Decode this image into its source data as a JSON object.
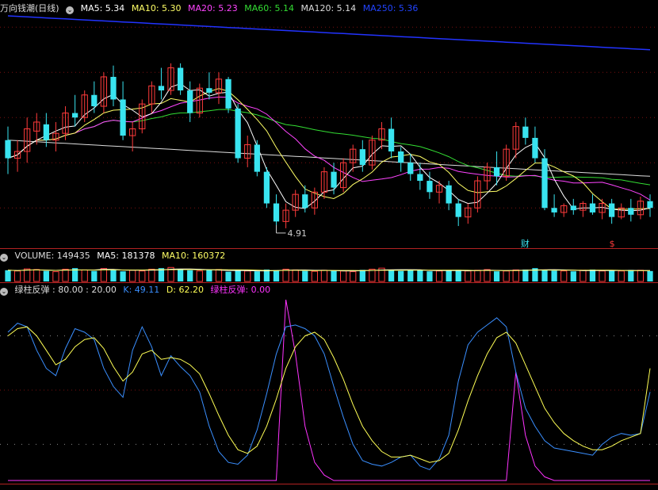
{
  "colors": {
    "up": "#ff3b3b",
    "down": "#39e4f0",
    "ma5": "#ffffff",
    "ma10": "#ffff66",
    "ma20": "#ff44ff",
    "ma60": "#33dd33",
    "ma120": "#dddddd",
    "ma250": "#2233ff",
    "k": "#3a8fff",
    "d": "#ffff55",
    "signal": "#ff33ff"
  },
  "icons": {
    "panel_toggle": "circle-chevron-down-icon"
  },
  "price_panel": {
    "title": "万向钱潮(日线)",
    "ma": [
      {
        "label": "MA5: 5.34"
      },
      {
        "label": "MA10: 5.30"
      },
      {
        "label": "MA20: 5.23"
      },
      {
        "label": "MA60: 5.14"
      },
      {
        "label": "MA120: 5.14"
      },
      {
        "label": "MA250: 5.36"
      }
    ],
    "low_marker": "4.91",
    "event_marks": [
      "财",
      "$"
    ]
  },
  "volume_panel": {
    "title": "VOLUME: 149435",
    "ma5": "MA5: 181378",
    "ma10": "MA10: 160372"
  },
  "indicator_panel": {
    "title": "绿柱反弹 : 80.00 : 20.00",
    "k": "K: 49.11",
    "d": "D: 62.20",
    "signal": "绿柱反弹: 0.00"
  },
  "chart_data": {
    "type": "candlestick",
    "bars": 68,
    "price_range": [
      4.85,
      5.85
    ],
    "ohlc_approx": [
      [
        5.3,
        5.36,
        5.15,
        5.22
      ],
      [
        5.22,
        5.3,
        5.16,
        5.25
      ],
      [
        5.25,
        5.4,
        5.2,
        5.35
      ],
      [
        5.34,
        5.42,
        5.28,
        5.38
      ],
      [
        5.37,
        5.42,
        5.27,
        5.3
      ],
      [
        5.3,
        5.38,
        5.25,
        5.33
      ],
      [
        5.33,
        5.45,
        5.3,
        5.42
      ],
      [
        5.42,
        5.5,
        5.36,
        5.4
      ],
      [
        5.4,
        5.52,
        5.38,
        5.5
      ],
      [
        5.5,
        5.56,
        5.42,
        5.45
      ],
      [
        5.45,
        5.6,
        5.42,
        5.58
      ],
      [
        5.58,
        5.63,
        5.45,
        5.48
      ],
      [
        5.48,
        5.56,
        5.3,
        5.32
      ],
      [
        5.32,
        5.38,
        5.25,
        5.35
      ],
      [
        5.35,
        5.48,
        5.33,
        5.46
      ],
      [
        5.46,
        5.56,
        5.42,
        5.54
      ],
      [
        5.54,
        5.62,
        5.48,
        5.52
      ],
      [
        5.52,
        5.64,
        5.5,
        5.62
      ],
      [
        5.62,
        5.64,
        5.5,
        5.52
      ],
      [
        5.52,
        5.56,
        5.38,
        5.42
      ],
      [
        5.42,
        5.55,
        5.4,
        5.53
      ],
      [
        5.53,
        5.6,
        5.48,
        5.51
      ],
      [
        5.51,
        5.6,
        5.46,
        5.57
      ],
      [
        5.57,
        5.58,
        5.42,
        5.44
      ],
      [
        5.44,
        5.46,
        5.2,
        5.22
      ],
      [
        5.22,
        5.32,
        5.18,
        5.28
      ],
      [
        5.28,
        5.3,
        5.14,
        5.16
      ],
      [
        5.16,
        5.18,
        5.0,
        5.02
      ],
      [
        5.02,
        5.06,
        4.9,
        4.94
      ],
      [
        4.94,
        5.02,
        4.91,
        4.99
      ],
      [
        4.99,
        5.08,
        4.96,
        5.06
      ],
      [
        5.06,
        5.1,
        4.98,
        5.0
      ],
      [
        5.0,
        5.09,
        4.97,
        5.07
      ],
      [
        5.07,
        5.18,
        5.04,
        5.16
      ],
      [
        5.16,
        5.2,
        5.06,
        5.09
      ],
      [
        5.09,
        5.22,
        5.07,
        5.2
      ],
      [
        5.2,
        5.28,
        5.16,
        5.26
      ],
      [
        5.26,
        5.3,
        5.16,
        5.19
      ],
      [
        5.19,
        5.32,
        5.17,
        5.3
      ],
      [
        5.3,
        5.38,
        5.26,
        5.35
      ],
      [
        5.35,
        5.4,
        5.22,
        5.25
      ],
      [
        5.25,
        5.27,
        5.16,
        5.2
      ],
      [
        5.2,
        5.24,
        5.12,
        5.15
      ],
      [
        5.15,
        5.2,
        5.08,
        5.12
      ],
      [
        5.12,
        5.16,
        5.04,
        5.07
      ],
      [
        5.07,
        5.12,
        5.02,
        5.1
      ],
      [
        5.1,
        5.12,
        4.99,
        5.02
      ],
      [
        5.02,
        5.04,
        4.92,
        4.96
      ],
      [
        4.96,
        5.02,
        4.93,
        5.0
      ],
      [
        5.0,
        5.14,
        4.98,
        5.12
      ],
      [
        5.12,
        5.2,
        5.08,
        5.18
      ],
      [
        5.18,
        5.25,
        5.1,
        5.14
      ],
      [
        5.14,
        5.28,
        5.12,
        5.26
      ],
      [
        5.26,
        5.38,
        5.22,
        5.36
      ],
      [
        5.36,
        5.4,
        5.28,
        5.31
      ],
      [
        5.31,
        5.36,
        5.2,
        5.22
      ],
      [
        5.22,
        5.26,
        4.99,
        5.0
      ],
      [
        5.0,
        5.06,
        4.96,
        4.98
      ],
      [
        4.98,
        5.02,
        4.96,
        5.01
      ],
      [
        5.01,
        5.04,
        4.97,
        4.99
      ],
      [
        4.99,
        5.03,
        4.96,
        5.02
      ],
      [
        5.02,
        5.06,
        4.97,
        4.98
      ],
      [
        4.98,
        5.04,
        4.95,
        5.02
      ],
      [
        5.02,
        5.04,
        4.93,
        4.96
      ],
      [
        4.96,
        5.02,
        4.95,
        5.0
      ],
      [
        5.0,
        5.04,
        4.94,
        4.97
      ],
      [
        4.97,
        5.05,
        4.95,
        5.03
      ],
      [
        5.03,
        5.06,
        4.96,
        5.0
      ]
    ],
    "ma250_range": [
      5.85,
      5.7
    ],
    "volume_approx": [
      160,
      150,
      180,
      170,
      150,
      140,
      175,
      190,
      165,
      150,
      185,
      170,
      145,
      160,
      150,
      175,
      190,
      200,
      170,
      160,
      150,
      165,
      170,
      140,
      155,
      150,
      145,
      170,
      160,
      175,
      165,
      150,
      145,
      160,
      155,
      150,
      140,
      165,
      175,
      190,
      160,
      150,
      170,
      160,
      145,
      150,
      155,
      165,
      150,
      160,
      170,
      145,
      150,
      165,
      170,
      190,
      160,
      155,
      150,
      145,
      160,
      170,
      150,
      155,
      150,
      165,
      160,
      149
    ],
    "volume_range": [
      0,
      260
    ],
    "indicator_range": [
      0,
      100
    ],
    "levels": [
      80,
      20
    ],
    "k_approx": [
      82,
      87,
      85,
      72,
      62,
      58,
      73,
      84,
      82,
      78,
      62,
      52,
      46,
      72,
      85,
      74,
      58,
      69,
      63,
      58,
      49,
      30,
      16,
      10,
      9,
      14,
      28,
      48,
      70,
      85,
      86,
      84,
      80,
      70,
      52,
      35,
      20,
      11,
      9,
      8,
      10,
      13,
      14,
      8,
      6,
      12,
      25,
      55,
      75,
      82,
      86,
      90,
      85,
      60,
      40,
      30,
      22,
      18,
      17,
      16,
      15,
      14,
      20,
      24,
      26,
      25,
      26,
      49
    ],
    "d_approx": [
      80,
      84,
      85,
      80,
      72,
      64,
      67,
      74,
      78,
      79,
      73,
      63,
      55,
      60,
      70,
      72,
      67,
      68,
      67,
      64,
      59,
      48,
      36,
      25,
      17,
      15,
      19,
      30,
      45,
      62,
      74,
      80,
      82,
      78,
      68,
      56,
      42,
      30,
      22,
      16,
      13,
      13,
      14,
      12,
      10,
      11,
      15,
      28,
      44,
      58,
      70,
      79,
      82,
      76,
      64,
      52,
      40,
      32,
      26,
      22,
      19,
      17,
      17,
      19,
      22,
      24,
      26,
      62
    ],
    "signal_approx": [
      0,
      0,
      0,
      0,
      0,
      0,
      0,
      0,
      0,
      0,
      0,
      0,
      0,
      0,
      0,
      0,
      0,
      0,
      0,
      0,
      0,
      0,
      0,
      0,
      0,
      0,
      0,
      0,
      0,
      100,
      70,
      30,
      10,
      3,
      0,
      0,
      0,
      0,
      0,
      0,
      0,
      0,
      0,
      0,
      0,
      0,
      0,
      0,
      0,
      0,
      0,
      0,
      0,
      60,
      25,
      8,
      2,
      0,
      0,
      0,
      0,
      0,
      0,
      0,
      0,
      0,
      0,
      0
    ]
  }
}
